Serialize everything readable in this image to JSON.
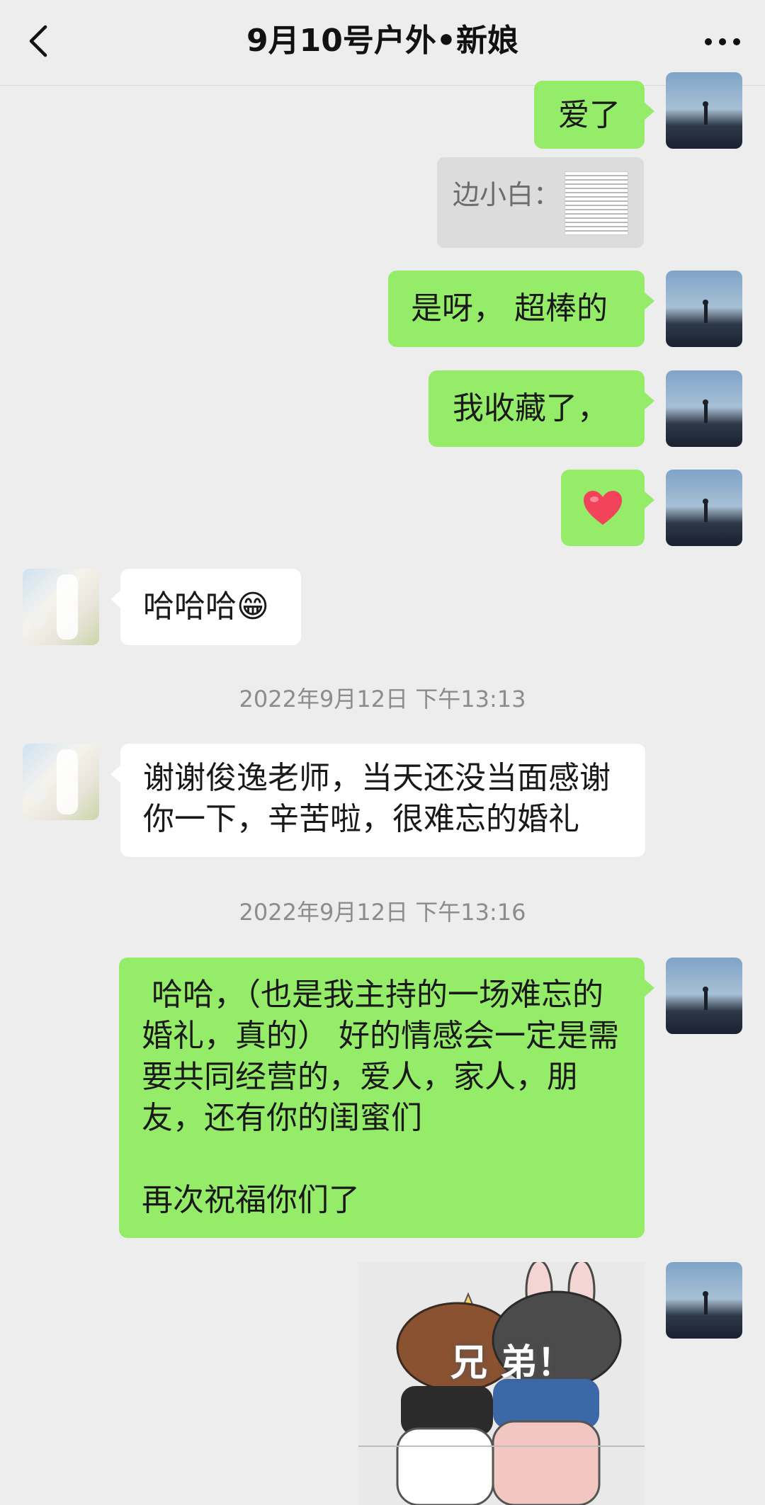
{
  "header": {
    "title": "9月10号户外•新娘"
  },
  "messages": {
    "m1": "爱了",
    "quote_label": "边小白：",
    "m2": "是呀， 超棒的",
    "m3": "我收藏了，",
    "m5": "哈哈哈😁",
    "ts1": "2022年9月12日 下午13:13",
    "m6": "谢谢俊逸老师，当天还没当面感谢你一下，辛苦啦，很难忘的婚礼",
    "ts2": "2022年9月12日 下午13:16",
    "m7": " 哈哈，（也是我主持的一场难忘的婚礼，真的） 好的情感会一定是需要共同经营的，爱人，家人，朋友，还有你的闺蜜们\n\n再次祝福你们了",
    "sticker_text": "兄 弟！"
  },
  "icons": {
    "back": "chevron-left-icon",
    "more": "more-dots-icon",
    "heart": "heart-icon"
  },
  "colors": {
    "background": "#ededed",
    "self_bubble": "#95ec69",
    "other_bubble": "#ffffff",
    "heart": "#f2435a"
  }
}
